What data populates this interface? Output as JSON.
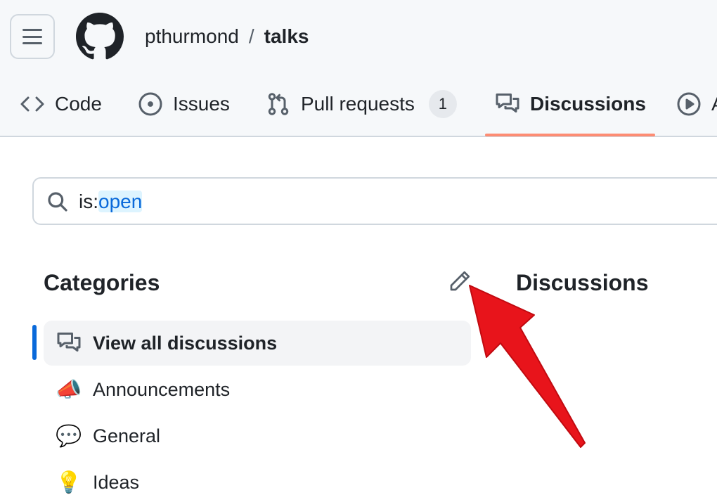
{
  "header": {
    "owner": "pthurmond",
    "separator": "/",
    "repo": "talks"
  },
  "tabs": [
    {
      "label": "Code",
      "icon": "code-icon"
    },
    {
      "label": "Issues",
      "icon": "issue-opened-icon"
    },
    {
      "label": "Pull requests",
      "icon": "git-pull-request-icon",
      "counter": "1"
    },
    {
      "label": "Discussions",
      "icon": "comment-discussion-icon",
      "active": true
    },
    {
      "label": "A",
      "icon": "play-icon"
    }
  ],
  "search": {
    "prefix": "is:",
    "value": "open"
  },
  "categories": {
    "heading": "Categories",
    "items": [
      {
        "label": "View all discussions",
        "icon": "comment-discussion-icon",
        "selected": true
      },
      {
        "label": "Announcements",
        "icon": "📣"
      },
      {
        "label": "General",
        "icon": "💬"
      },
      {
        "label": "Ideas",
        "icon": "💡"
      }
    ]
  },
  "discussions": {
    "heading": "Discussions"
  },
  "colors": {
    "accent": "#0969da",
    "tab_underline": "#fd8c73",
    "annotation_arrow": "#e8141b"
  }
}
